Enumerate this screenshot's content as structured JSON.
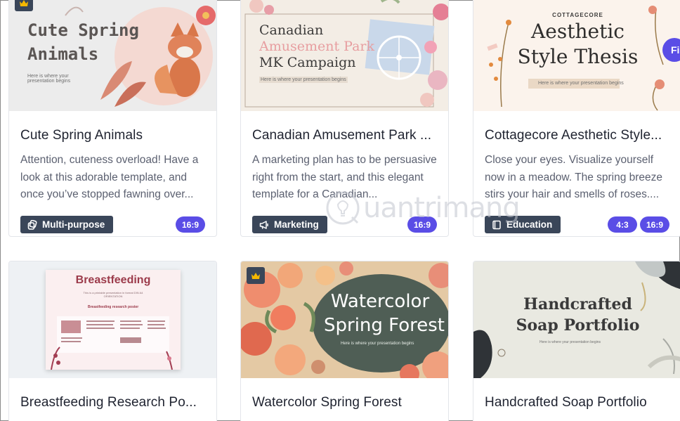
{
  "cards": [
    {
      "thumb_title": "Cute Spring\nAnimals",
      "thumb_sub": "Here is where your\npresentation begins",
      "title": "Cute Spring Animals",
      "desc": "Attention, cuteness overload! Have a look at this adorable template, and once you’ve stopped fawning over...",
      "category": "Multi-purpose",
      "category_icon": "copy-icon",
      "ratios": [
        "16:9"
      ],
      "premium": true
    },
    {
      "thumb_title_1": "Canadian",
      "thumb_title_2": "Amusement Park",
      "thumb_title_3": "MK Campaign",
      "thumb_sub": "Here is where your presentation begins",
      "title": "Canadian Amusement Park ...",
      "desc": "A marketing plan has to be persuasive right from the start, and this elegant template for a Canadian...",
      "category": "Marketing",
      "category_icon": "megaphone-icon",
      "ratios": [
        "16:9"
      ],
      "premium": false
    },
    {
      "thumb_kicker": "COTTAGECORE",
      "thumb_title": "Aesthetic\nStyle Thesis",
      "thumb_sub": "Here is where your presentation begins",
      "title": "Cottagecore Aesthetic Style...",
      "desc": "Close your eyes. Visualize yourself now in a meadow. The spring breeze stirs your hair and smells of roses....",
      "category": "Education",
      "category_icon": "book-icon",
      "ratios": [
        "4:3",
        "16:9"
      ],
      "premium": false,
      "side_button": "Fi"
    },
    {
      "thumb_title": "Breastfeeding",
      "thumb_sub": "This is a printable presentation in format DIN A4 ORIENTATION",
      "thumb_poster": "Breastfeeding research poster",
      "title": "Breastfeeding Research Po...",
      "premium": false
    },
    {
      "thumb_title": "Watercolor\nSpring Forest",
      "thumb_sub": "Here is where your presentation begins",
      "title": "Watercolor Spring Forest",
      "premium": true
    },
    {
      "thumb_title": "Handcrafted\nSoap Portfolio",
      "thumb_sub": "Here is where your presentation begins",
      "title": "Handcrafted Soap Portfolio",
      "premium": false
    }
  ],
  "watermark": "uantrimang",
  "colors": {
    "accent": "#5a4de6",
    "tag_bg": "#3a4659",
    "title_text": "#1f2330",
    "desc_text": "#5b6070"
  }
}
